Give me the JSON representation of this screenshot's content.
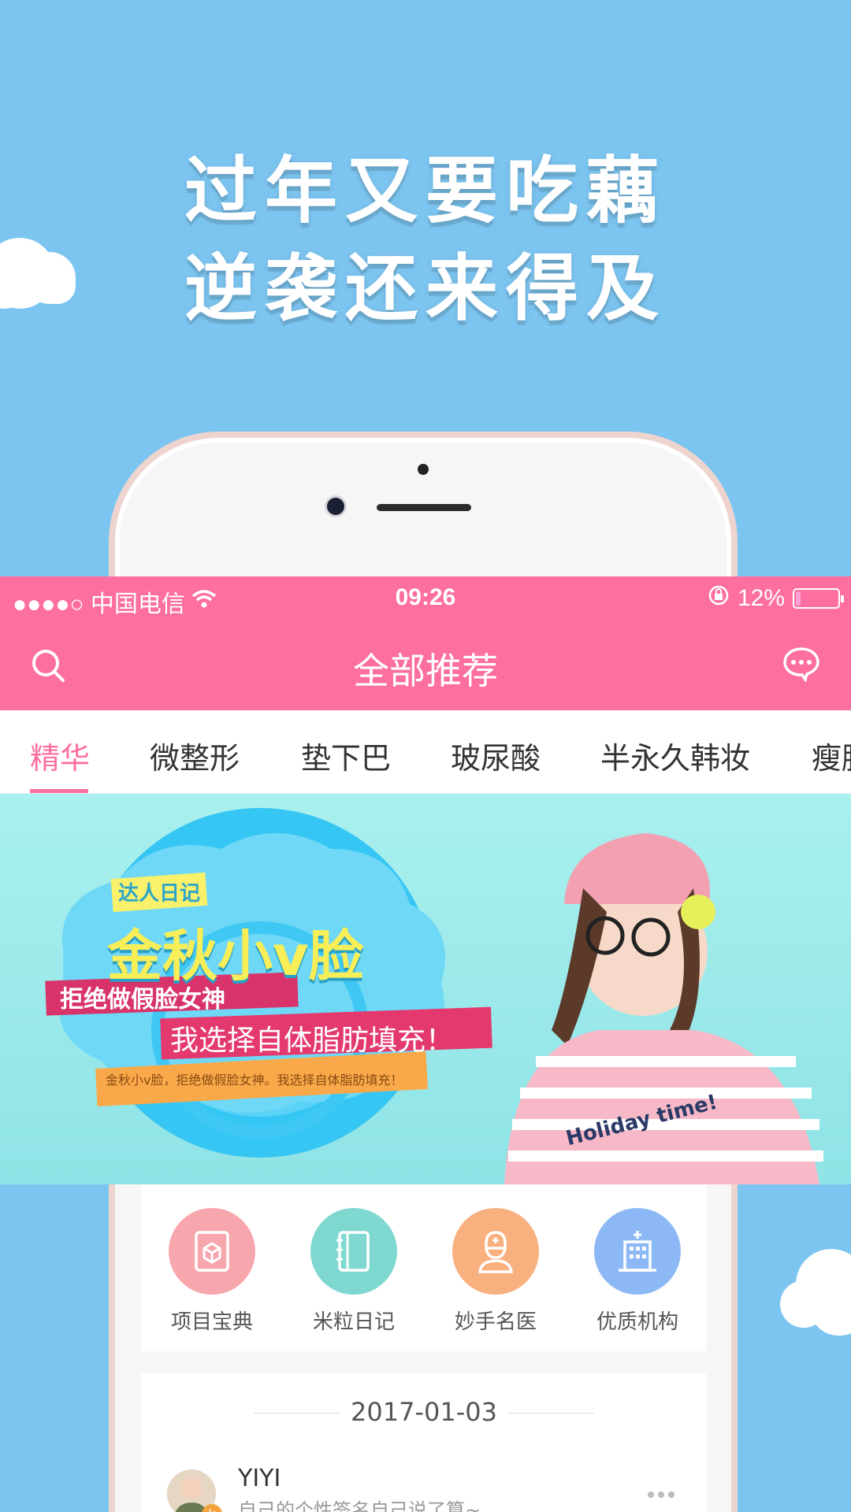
{
  "promo": {
    "line1": "过年又要吃藕",
    "line2": "逆袭还来得及"
  },
  "status": {
    "carrier": "●●●●○ 中国电信",
    "time": "09:26",
    "battery_text": "12%",
    "battery_level": 0.12
  },
  "nav": {
    "title": "全部推荐",
    "search_icon": "search-icon",
    "message_icon": "message-icon"
  },
  "tabs": [
    "精华",
    "微整形",
    "垫下巴",
    "玻尿酸",
    "半永久韩妆",
    "瘦脸"
  ],
  "banner": {
    "tag": "达人日记",
    "title": "金秋小v脸",
    "sub1": "拒绝做假脸女神",
    "sub2": "我选择自体脂肪填充！",
    "ribbon": "金秋小v脸，拒绝做假脸女神。我选择自体脂肪填充！",
    "shirt_text": "Holiday time!"
  },
  "quick_links": [
    {
      "label": "项目宝典",
      "icon": "book-icon",
      "color": "#f7a6ad"
    },
    {
      "label": "米粒日记",
      "icon": "notebook-icon",
      "color": "#7fd8d0"
    },
    {
      "label": "妙手名医",
      "icon": "doctor-icon",
      "color": "#f9b07f"
    },
    {
      "label": "优质机构",
      "icon": "hospital-icon",
      "color": "#8cb9f5"
    }
  ],
  "feed": {
    "date": "2017-01-03",
    "username": "YIYI",
    "signature": "自己的个性签名自己说了算~",
    "badge": "k"
  },
  "colors": {
    "brand_pink": "#fd6fa0",
    "sky": "#7cc5f0"
  }
}
